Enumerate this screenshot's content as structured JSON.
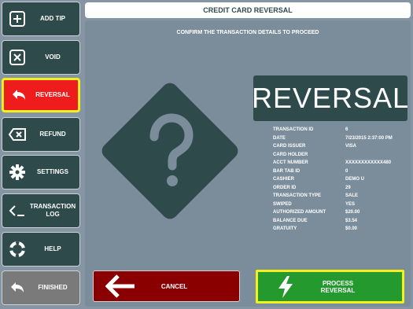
{
  "sidebar": {
    "items": [
      {
        "label": "ADD TIP",
        "icon": "plus-box-icon"
      },
      {
        "label": "VOID",
        "icon": "x-box-icon"
      },
      {
        "label": "REVERSAL",
        "icon": "undo-arrow-icon",
        "active": true
      },
      {
        "label": "REFUND",
        "icon": "backspace-icon"
      },
      {
        "label": "SETTINGS",
        "icon": "gear-icon"
      },
      {
        "label": "TRANSACTION LOG",
        "icon": "code-brackets-icon"
      },
      {
        "label": "HELP",
        "icon": "lifebuoy-icon"
      },
      {
        "label": "FINISHED",
        "icon": "undo-arrow-icon"
      }
    ]
  },
  "header": {
    "title": "CREDIT CARD REVERSAL"
  },
  "main": {
    "instruction": "CONFIRM THE TRANSACTION DETAILS TO PROCEED",
    "status_word": "REVERSAL",
    "details": [
      {
        "key": "TRANSACTION ID",
        "value": "6"
      },
      {
        "key": "DATE",
        "value": "7/23/2015 2:37:00 PM"
      },
      {
        "key": "CARD ISSUER",
        "value": "VISA"
      },
      {
        "key": "CARD HOLDER",
        "value": ""
      },
      {
        "key": "ACCT NUMBER",
        "value": "XXXXXXXXXXXX480"
      },
      {
        "key": "BAR TAB ID",
        "value": "0"
      },
      {
        "key": "CASHIER",
        "value": "DEMO U"
      },
      {
        "key": "ORDER ID",
        "value": "29"
      },
      {
        "key": "TRANSACTION TYPE",
        "value": "SALE"
      },
      {
        "key": "SWIPED",
        "value": "YES"
      },
      {
        "key": "AUTHORIZED AMOUNT",
        "value": "$20.00"
      },
      {
        "key": "BALANCE DUE",
        "value": "$3.54"
      },
      {
        "key": "GRATUITY",
        "value": "$0.00"
      }
    ]
  },
  "actions": {
    "cancel_label": "CANCEL",
    "process_label": "PROCESS REVERSAL"
  },
  "colors": {
    "panel": "#7b8d9b",
    "dark_teal": "#2e4a4a",
    "active_red": "#ee1c1c",
    "highlight_yellow": "#f5ef1a",
    "cancel_red": "#8a0000",
    "process_green": "#249a2e"
  }
}
